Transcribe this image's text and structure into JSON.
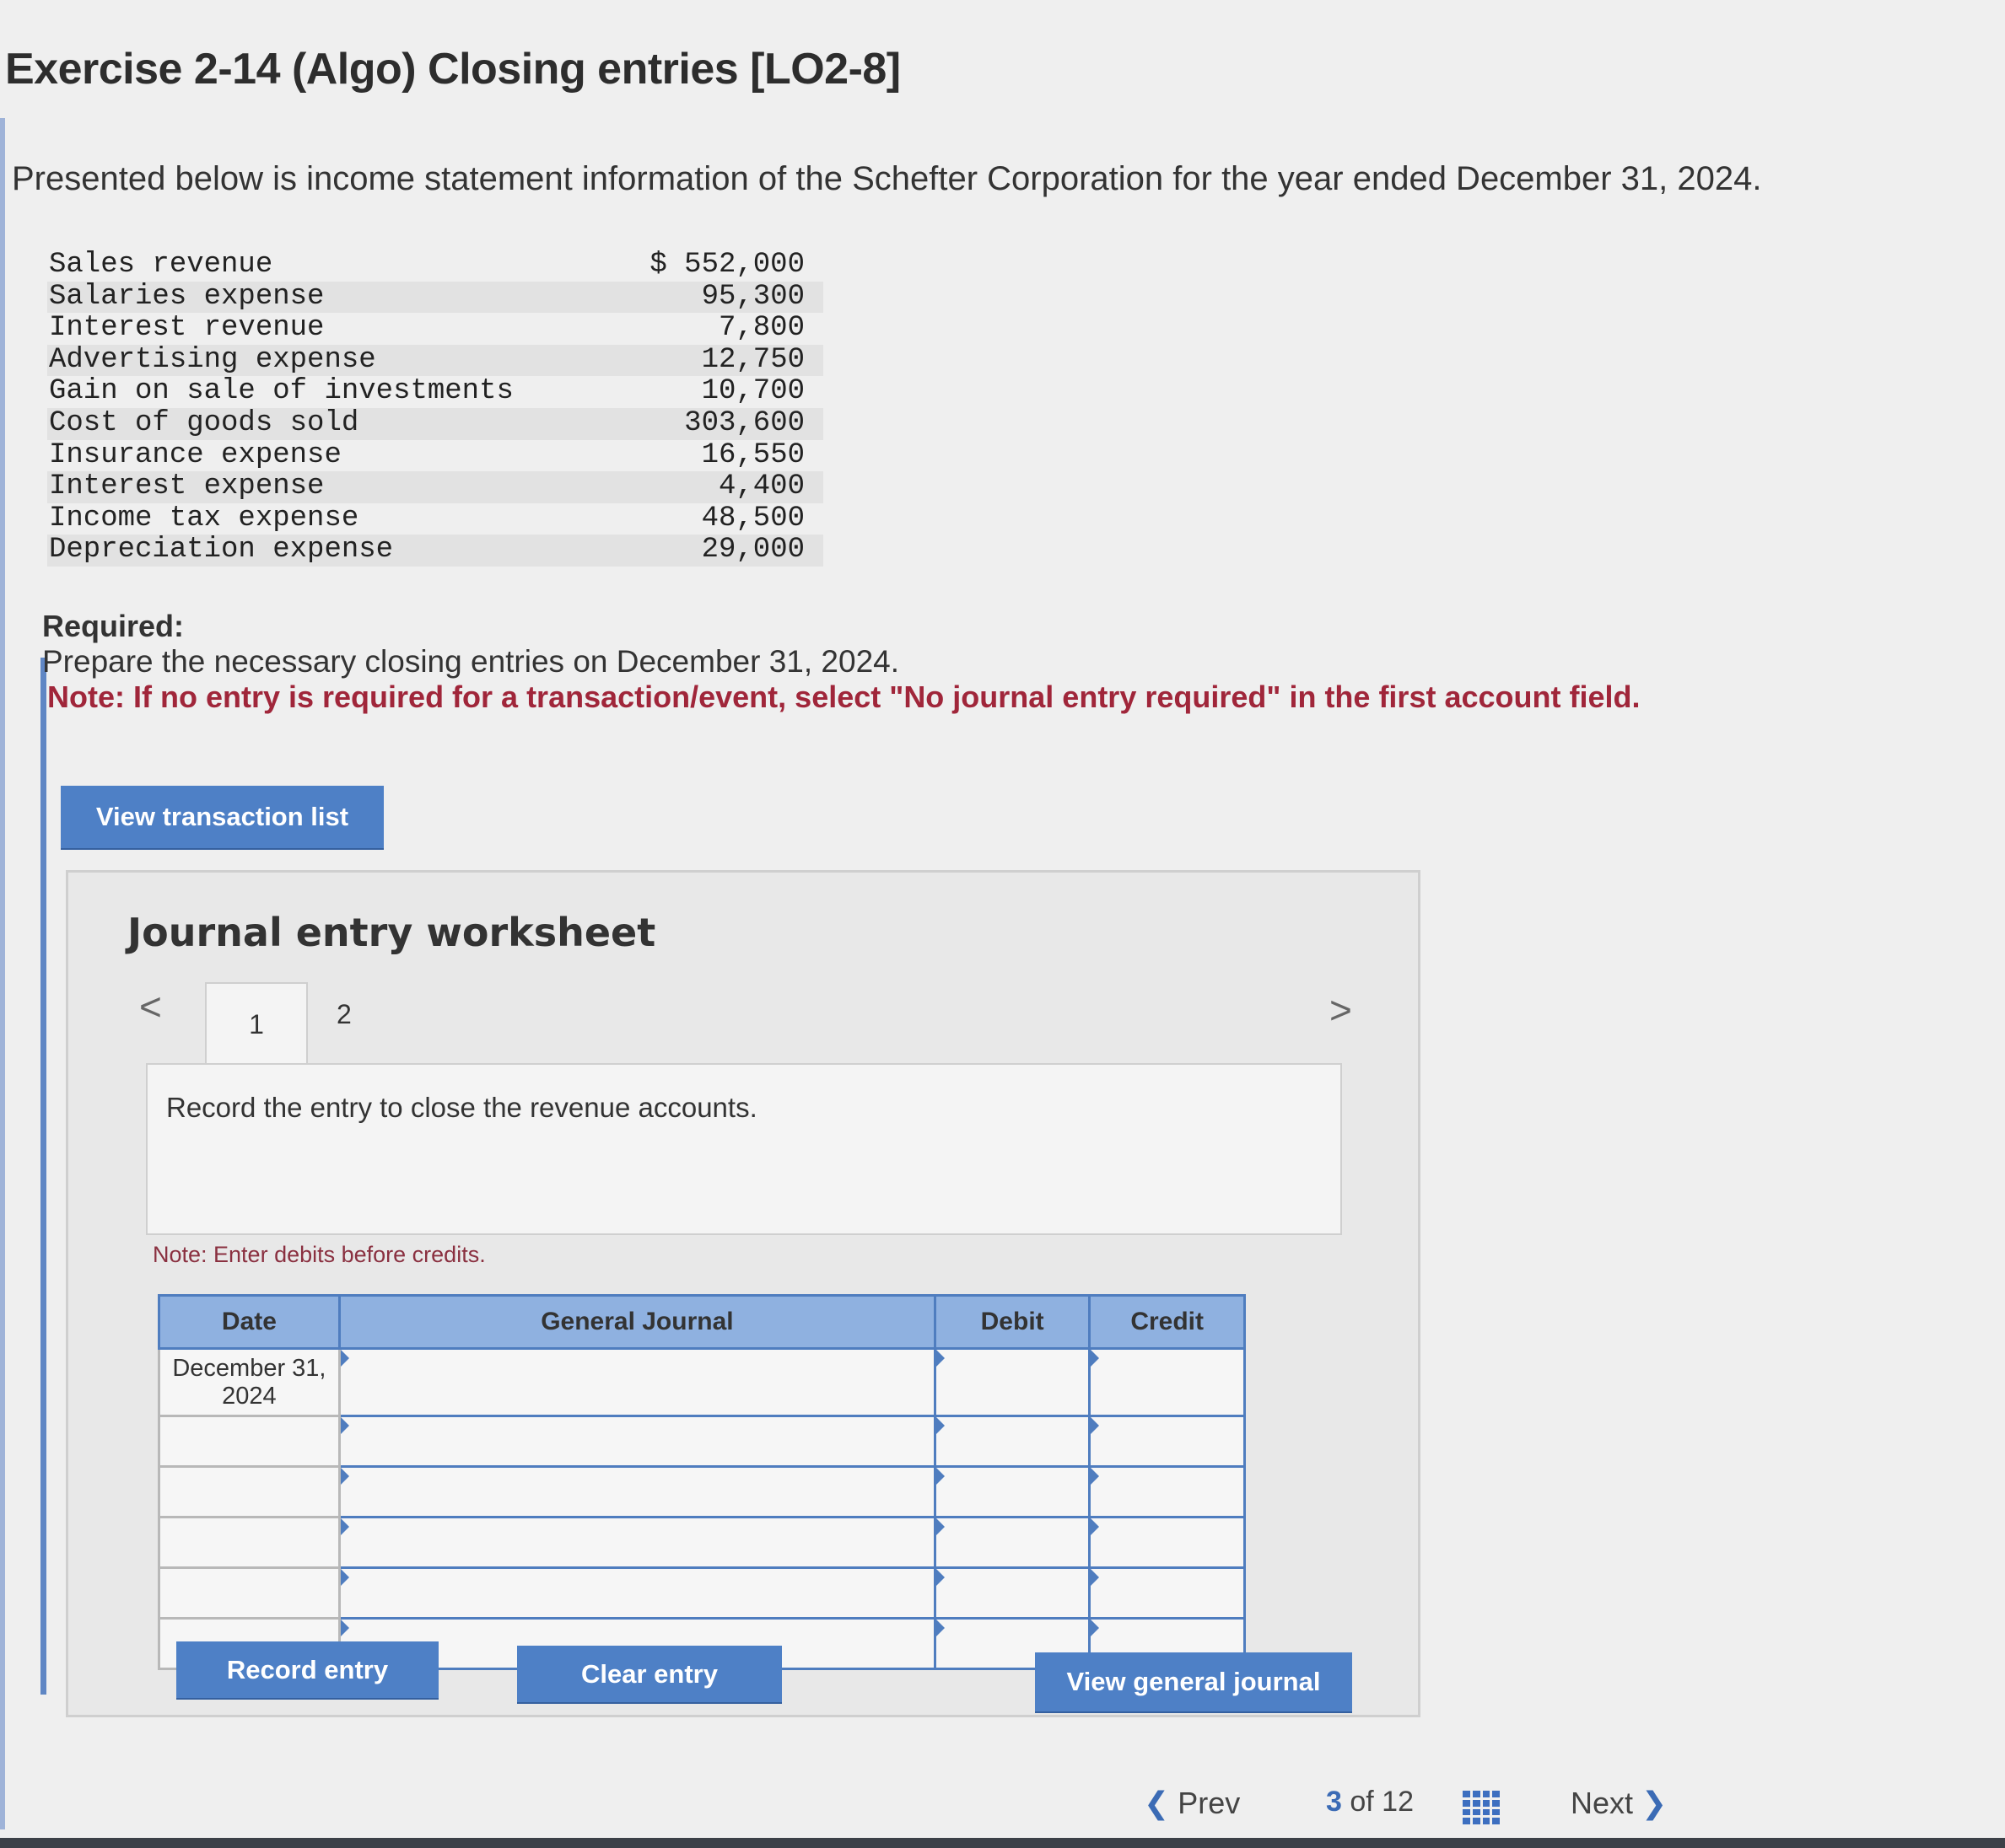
{
  "page": {
    "title": "Exercise 2-14 (Algo) Closing entries [LO2-8]",
    "intro": "Presented below is income statement information of the Schefter Corporation for the year ended December 31, 2024."
  },
  "statement": [
    {
      "label": "Sales revenue",
      "value": "$ 552,000"
    },
    {
      "label": "Salaries expense",
      "value": "95,300"
    },
    {
      "label": "Interest revenue",
      "value": "7,800"
    },
    {
      "label": "Advertising expense",
      "value": "12,750"
    },
    {
      "label": "Gain on sale of investments",
      "value": "10,700"
    },
    {
      "label": "Cost of goods sold",
      "value": "303,600"
    },
    {
      "label": "Insurance expense",
      "value": "16,550"
    },
    {
      "label": "Interest expense",
      "value": "4,400"
    },
    {
      "label": "Income tax expense",
      "value": "48,500"
    },
    {
      "label": "Depreciation expense",
      "value": "29,000"
    }
  ],
  "required": {
    "heading": "Required:",
    "text": "Prepare the necessary closing entries on December 31, 2024.",
    "note": "Note: If no entry is required for a transaction/event, select \"No journal entry required\" in the first account field."
  },
  "buttons": {
    "view_transaction_list": "View transaction list",
    "record_entry": "Record entry",
    "clear_entry": "Clear entry",
    "view_general_journal": "View general journal"
  },
  "worksheet": {
    "title": "Journal entry worksheet",
    "tabs": [
      "1",
      "2"
    ],
    "nav_prev": "<",
    "nav_next": ">",
    "instruction": "Record the entry to close the revenue accounts.",
    "note": "Note: Enter debits before credits.",
    "columns": [
      "Date",
      "General Journal",
      "Debit",
      "Credit"
    ],
    "rows": [
      {
        "date": "December 31, 2024"
      },
      {
        "date": ""
      },
      {
        "date": ""
      },
      {
        "date": ""
      },
      {
        "date": ""
      },
      {
        "date": ""
      }
    ]
  },
  "pager": {
    "prev": "Prev",
    "current": "3",
    "of_text": "of 12",
    "next": "Next"
  },
  "colors": {
    "button": "#4e80c6",
    "header": "#8fb1e0",
    "note_red": "#a0263a"
  }
}
